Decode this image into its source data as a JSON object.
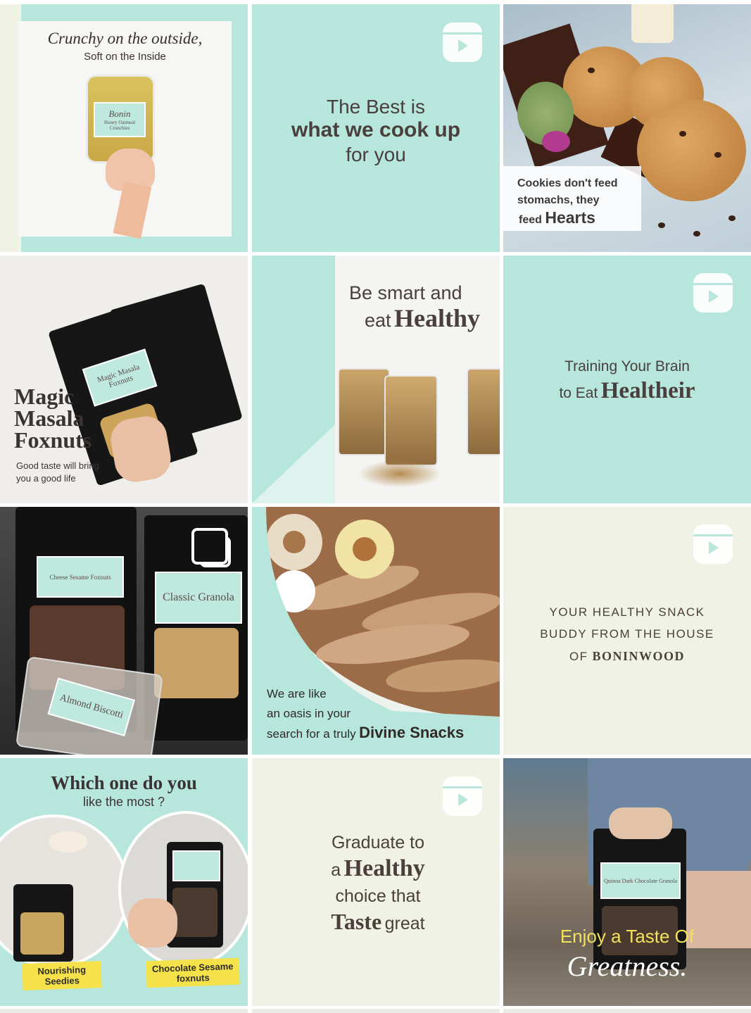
{
  "posts": [
    {
      "type": "image",
      "line1": "Crunchy on the outside,",
      "line2": "Soft on the Inside",
      "jar_brand": "Bonin",
      "jar_label": "Honey Oatmeal Crunchies"
    },
    {
      "type": "reel",
      "line1": "The Best is",
      "line2": "what we cook up",
      "line3": "for you"
    },
    {
      "type": "image",
      "line1": "Cookies don't feed",
      "line2": "stomachs, they",
      "line3_small": "feed",
      "line3_big": "Hearts"
    },
    {
      "type": "image",
      "heading1": "Magic",
      "heading2": "Masala",
      "heading3": "Foxnuts",
      "sub1": "Good taste will bring",
      "sub2": "you a good life",
      "pouch_label": "Magic Masala Foxnuts"
    },
    {
      "type": "image",
      "line1": "Be smart and",
      "line2_small": "eat",
      "line2_big": "Healthy"
    },
    {
      "type": "reel",
      "line1": "Training Your Brain",
      "line2_small": "to Eat",
      "line2_big": "Healtheir"
    },
    {
      "type": "carousel",
      "label1": "Classic Granola",
      "label2": "Almond Biscotti",
      "label3": "Cheese Sesame Foxnuts"
    },
    {
      "type": "image",
      "line1": "We are like",
      "line2": "an oasis in your",
      "line3_small": "search for a truly",
      "line3_big": "Divine Snacks"
    },
    {
      "type": "reel",
      "line1": "YOUR HEALTHY SNACK",
      "line2": "BUDDY FROM THE HOUSE",
      "line3_small": "OF",
      "line3_big": "BONINWOOD"
    },
    {
      "type": "image",
      "heading": "Which one do you",
      "sub": "like the most ?",
      "tag1": "Nourishing Seedies",
      "tag2": "Chocolate Sesame foxnuts"
    },
    {
      "type": "reel",
      "line1": "Graduate to",
      "line2_small": "a",
      "line2_big": "Healthy",
      "line3": "choice that",
      "line4_big": "Taste",
      "line4_small": "great"
    },
    {
      "type": "image",
      "line1": "Enjoy a Taste Of",
      "line2": "Greatness.",
      "pouch_label": "Quinoa Dark Chocolate Granola"
    }
  ],
  "colors": {
    "mint": "#b6e6dc",
    "cream": "#f1f2e6",
    "text": "#4a3f3c"
  }
}
